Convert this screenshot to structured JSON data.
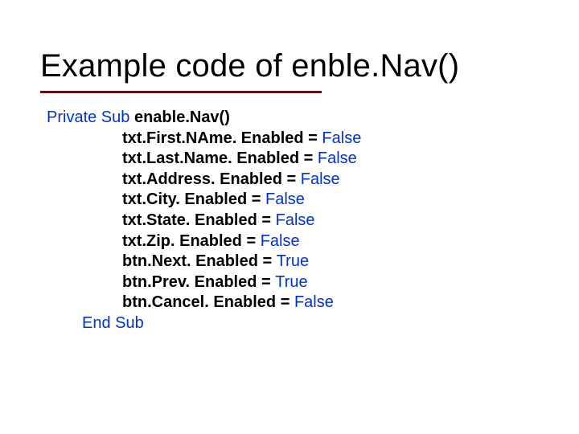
{
  "title": "Example code of enble.Nav()",
  "code": {
    "sub_keyword_private": "Private Sub",
    "sub_name": "enable.Nav()",
    "lines": [
      {
        "obj": "txt.First.NAme. Enabled",
        "eq": " = ",
        "val": "False"
      },
      {
        "obj": "txt.Last.Name. Enabled",
        "eq": " = ",
        "val": "False"
      },
      {
        "obj": "txt.Address. Enabled",
        "eq": " = ",
        "val": "False"
      },
      {
        "obj": "txt.City. Enabled",
        "eq": " = ",
        "val": "False"
      },
      {
        "obj": "txt.State. Enabled",
        "eq": " = ",
        "val": "False"
      },
      {
        "obj": "txt.Zip. Enabled",
        "eq": " = ",
        "val": "False"
      },
      {
        "obj": "btn.Next. Enabled",
        "eq": " = ",
        "val": "True"
      },
      {
        "obj": "btn.Prev. Enabled",
        "eq": " = ",
        "val": "True"
      },
      {
        "obj": "btn.Cancel. Enabled",
        "eq": " = ",
        "val": "False"
      }
    ],
    "end_sub": "End Sub"
  }
}
